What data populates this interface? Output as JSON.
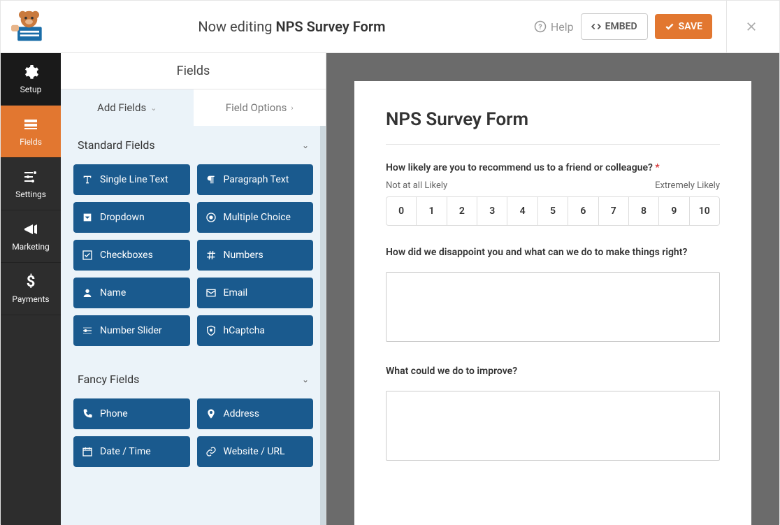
{
  "header": {
    "editing_prefix": "Now editing ",
    "form_name": "NPS Survey Form",
    "help": "Help",
    "embed": "EMBED",
    "save": "SAVE"
  },
  "sidenav": {
    "setup": "Setup",
    "fields": "Fields",
    "settings": "Settings",
    "marketing": "Marketing",
    "payments": "Payments"
  },
  "panel": {
    "section_title": "Fields",
    "tab_add": "Add Fields",
    "tab_options": "Field Options",
    "group_standard": "Standard Fields",
    "group_fancy": "Fancy Fields",
    "standard": [
      {
        "label": "Single Line Text",
        "icon": "text"
      },
      {
        "label": "Paragraph Text",
        "icon": "paragraph"
      },
      {
        "label": "Dropdown",
        "icon": "dropdown"
      },
      {
        "label": "Multiple Choice",
        "icon": "radio"
      },
      {
        "label": "Checkboxes",
        "icon": "check"
      },
      {
        "label": "Numbers",
        "icon": "hash"
      },
      {
        "label": "Name",
        "icon": "user"
      },
      {
        "label": "Email",
        "icon": "mail"
      },
      {
        "label": "Number Slider",
        "icon": "slider"
      },
      {
        "label": "hCaptcha",
        "icon": "shield"
      }
    ],
    "fancy": [
      {
        "label": "Phone",
        "icon": "phone"
      },
      {
        "label": "Address",
        "icon": "pin"
      },
      {
        "label": "Date / Time",
        "icon": "calendar"
      },
      {
        "label": "Website / URL",
        "icon": "link"
      }
    ]
  },
  "form": {
    "title": "NPS Survey Form",
    "q1": "How likely are you to recommend us to a friend or colleague?",
    "scale_low": "Not at all Likely",
    "scale_high": "Extremely Likely",
    "scale": [
      "0",
      "1",
      "2",
      "3",
      "4",
      "5",
      "6",
      "7",
      "8",
      "9",
      "10"
    ],
    "q2": "How did we disappoint you and what can we do to make things right?",
    "q3": "What could we do to improve?"
  }
}
